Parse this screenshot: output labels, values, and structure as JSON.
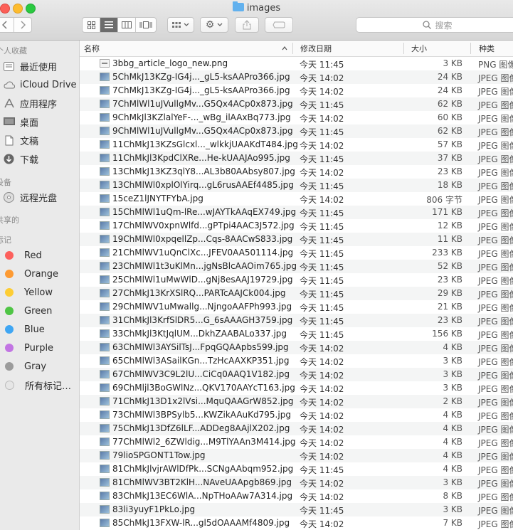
{
  "window": {
    "title": "images"
  },
  "toolbar": {
    "back_icon": "chevron-left",
    "forward_icon": "chevron-right",
    "view_modes": [
      "icon-view",
      "list-view",
      "column-view",
      "cover-flow-view"
    ],
    "search_placeholder": "搜索"
  },
  "sidebar": {
    "sections": {
      "favorites": "个人收藏",
      "devices": "设备",
      "shared": "共享的",
      "tags": "标记"
    },
    "favorites": [
      {
        "label": "最近使用",
        "icon": "recents-icon"
      },
      {
        "label": "iCloud Drive",
        "icon": "cloud-icon"
      },
      {
        "label": "应用程序",
        "icon": "applications-icon"
      },
      {
        "label": "桌面",
        "icon": "desktop-icon"
      },
      {
        "label": "文稿",
        "icon": "documents-icon"
      },
      {
        "label": "下载",
        "icon": "downloads-icon"
      }
    ],
    "devices": [
      {
        "label": "远程光盘",
        "icon": "disc-icon"
      }
    ],
    "tags": [
      {
        "label": "Red",
        "color": "#fc605c"
      },
      {
        "label": "Orange",
        "color": "#fd9a32"
      },
      {
        "label": "Yellow",
        "color": "#fdcd34"
      },
      {
        "label": "Green",
        "color": "#4fc545"
      },
      {
        "label": "Blue",
        "color": "#3fa6f3"
      },
      {
        "label": "Purple",
        "color": "#c275e3"
      },
      {
        "label": "Gray",
        "color": "#9b9b9b"
      },
      {
        "label": "所有标记…",
        "color": "#e6e6e6"
      }
    ]
  },
  "list": {
    "columns": {
      "name": "名称",
      "date": "修改日期",
      "size": "大小",
      "kind": "种类"
    },
    "files": [
      {
        "name": "3bbg_article_logo_new.png",
        "date": "今天 11:45",
        "size": "3 KB",
        "kind": "PNG 图像",
        "type": "png"
      },
      {
        "name": "5ChMkJ13KZg-IG4j..._gL5-ksAAPro366.jpg",
        "date": "今天 14:02",
        "size": "24 KB",
        "kind": "JPEG 图像",
        "type": "jpg"
      },
      {
        "name": "7ChMkJ13KZg-IG4j..._gL5-ksAAPro366.jpg",
        "date": "今天 14:02",
        "size": "24 KB",
        "kind": "JPEG 图像",
        "type": "jpg"
      },
      {
        "name": "7ChMlWl1uJVullgMv...G5Qx4ACp0x873.jpg",
        "date": "今天 11:45",
        "size": "62 KB",
        "kind": "JPEG 图像",
        "type": "jpg"
      },
      {
        "name": "9ChMkJl3KZlalYeF-..._wBg_ilAAxBq773.jpg",
        "date": "今天 14:02",
        "size": "60 KB",
        "kind": "JPEG 图像",
        "type": "jpg"
      },
      {
        "name": "9ChMlWl1uJVullgMv...G5Qx4ACp0x873.jpg",
        "date": "今天 11:45",
        "size": "62 KB",
        "kind": "JPEG 图像",
        "type": "jpg"
      },
      {
        "name": "11ChMkJ13KZsGlcxl..._wlkkjUAAKdT484.jpg",
        "date": "今天 14:02",
        "size": "57 KB",
        "kind": "JPEG 图像",
        "type": "jpg"
      },
      {
        "name": "11ChMkJl3KpdClXRe...He-kUAAJAo995.jpg",
        "date": "今天 11:45",
        "size": "37 KB",
        "kind": "JPEG 图像",
        "type": "jpg"
      },
      {
        "name": "13ChMkJ13KZ3qlY8...AL3b80AAbsy807.jpg",
        "date": "今天 14:02",
        "size": "23 KB",
        "kind": "JPEG 图像",
        "type": "jpg"
      },
      {
        "name": "13ChMlWl0xplOlYirq...gL6rusAAEf4485.jpg",
        "date": "今天 11:45",
        "size": "18 KB",
        "kind": "JPEG 图像",
        "type": "jpg"
      },
      {
        "name": "15ceZ1lJNYTFYbA.jpg",
        "date": "今天 14:02",
        "size": "806 字节",
        "kind": "JPEG 图像",
        "type": "jpg"
      },
      {
        "name": "15ChMlWl1uQm-lRe...wJAYTkAAqEX749.jpg",
        "date": "今天 11:45",
        "size": "171 KB",
        "kind": "JPEG 图像",
        "type": "jpg"
      },
      {
        "name": "17ChMlWV0xpnWlfd...gPTpi4AAC3J572.jpg",
        "date": "今天 11:45",
        "size": "12 KB",
        "kind": "JPEG 图像",
        "type": "jpg"
      },
      {
        "name": "19ChMlWl0xpqellZp...Cqs-8AACwS833.jpg",
        "date": "今天 11:45",
        "size": "11 KB",
        "kind": "JPEG 图像",
        "type": "jpg"
      },
      {
        "name": "21ChMlWV1uQnClXc...JFEV0AA501114.jpg",
        "date": "今天 11:45",
        "size": "233 KB",
        "kind": "JPEG 图像",
        "type": "jpg"
      },
      {
        "name": "23ChMlWl1t3uKlMn...jgNsBlcAAOim765.jpg",
        "date": "今天 11:45",
        "size": "52 KB",
        "kind": "JPEG 图像",
        "type": "jpg"
      },
      {
        "name": "25ChMlWl1uMwWlD...gNj8esAAJ19729.jpg",
        "date": "今天 11:45",
        "size": "23 KB",
        "kind": "JPEG 图像",
        "type": "jpg"
      },
      {
        "name": "27ChMkJ13KrXSlRQ...PARTcAAJCk004.jpg",
        "date": "今天 11:45",
        "size": "29 KB",
        "kind": "JPEG 图像",
        "type": "jpg"
      },
      {
        "name": "29ChMlWV1uMwallg...NjngoAAFPh993.jpg",
        "date": "今天 11:45",
        "size": "21 KB",
        "kind": "JPEG 图像",
        "type": "jpg"
      },
      {
        "name": "31ChMkJl3KrfSlDR5...G_6sAAAGH3759.jpg",
        "date": "今天 11:45",
        "size": "23 KB",
        "kind": "JPEG 图像",
        "type": "jpg"
      },
      {
        "name": "33ChMkJl3KtJqlUM...DkhZAABALo337.jpg",
        "date": "今天 11:45",
        "size": "156 KB",
        "kind": "JPEG 图像",
        "type": "jpg"
      },
      {
        "name": "63ChMlWl3AYSilTsJ...FpqGQAApbs599.jpg",
        "date": "今天 14:02",
        "size": "4 KB",
        "kind": "JPEG 图像",
        "type": "jpg"
      },
      {
        "name": "65ChMlWl3ASailKGn...TzHcAAXKP351.jpg",
        "date": "今天 14:02",
        "size": "3 KB",
        "kind": "JPEG 图像",
        "type": "jpg"
      },
      {
        "name": "67ChMlWV3C9L2lU...CiCq0AAQ1V182.jpg",
        "date": "今天 14:02",
        "size": "3 KB",
        "kind": "JPEG 图像",
        "type": "jpg"
      },
      {
        "name": "69ChMljl3BoGWlNz...QKV170AAYcT163.jpg",
        "date": "今天 14:02",
        "size": "3 KB",
        "kind": "JPEG 图像",
        "type": "jpg"
      },
      {
        "name": "71ChMkJ13D1x2lVsi...MquQAAGrW852.jpg",
        "date": "今天 14:02",
        "size": "2 KB",
        "kind": "JPEG 图像",
        "type": "jpg"
      },
      {
        "name": "73ChMlWl3BPSylb5...KWZikAAuKd795.jpg",
        "date": "今天 14:02",
        "size": "4 KB",
        "kind": "JPEG 图像",
        "type": "jpg"
      },
      {
        "name": "75ChMkJ13DfZ6lLF...ADDeg8AAjlX202.jpg",
        "date": "今天 14:02",
        "size": "4 KB",
        "kind": "JPEG 图像",
        "type": "jpg"
      },
      {
        "name": "77ChMlWl2_6ZWldig...M9TlYAAn3M414.jpg",
        "date": "今天 14:02",
        "size": "4 KB",
        "kind": "JPEG 图像",
        "type": "jpg"
      },
      {
        "name": "79lioSPGONT1Tow.jpg",
        "date": "今天 14:02",
        "size": "4 KB",
        "kind": "JPEG 图像",
        "type": "jpg"
      },
      {
        "name": "81ChMkJlvjrAWlDfPk...SCNgAAbqm952.jpg",
        "date": "今天 11:45",
        "size": "4 KB",
        "kind": "JPEG 图像",
        "type": "jpg"
      },
      {
        "name": "81ChMlWV3BT2KlH...NAveUAApgb869.jpg",
        "date": "今天 14:02",
        "size": "3 KB",
        "kind": "JPEG 图像",
        "type": "jpg"
      },
      {
        "name": "83ChMkJ13EC6WlA...NpTHoAAw7A314.jpg",
        "date": "今天 14:02",
        "size": "8 KB",
        "kind": "JPEG 图像",
        "type": "jpg"
      },
      {
        "name": "83li3yuyF1PkLo.jpg",
        "date": "今天 11:45",
        "size": "3 KB",
        "kind": "JPEG 图像",
        "type": "jpg"
      },
      {
        "name": "85ChMkJ13FXW-lR...gl5dOAAAMf4809.jpg",
        "date": "今天 14:02",
        "size": "7 KB",
        "kind": "JPEG 图像",
        "type": "jpg"
      }
    ]
  }
}
